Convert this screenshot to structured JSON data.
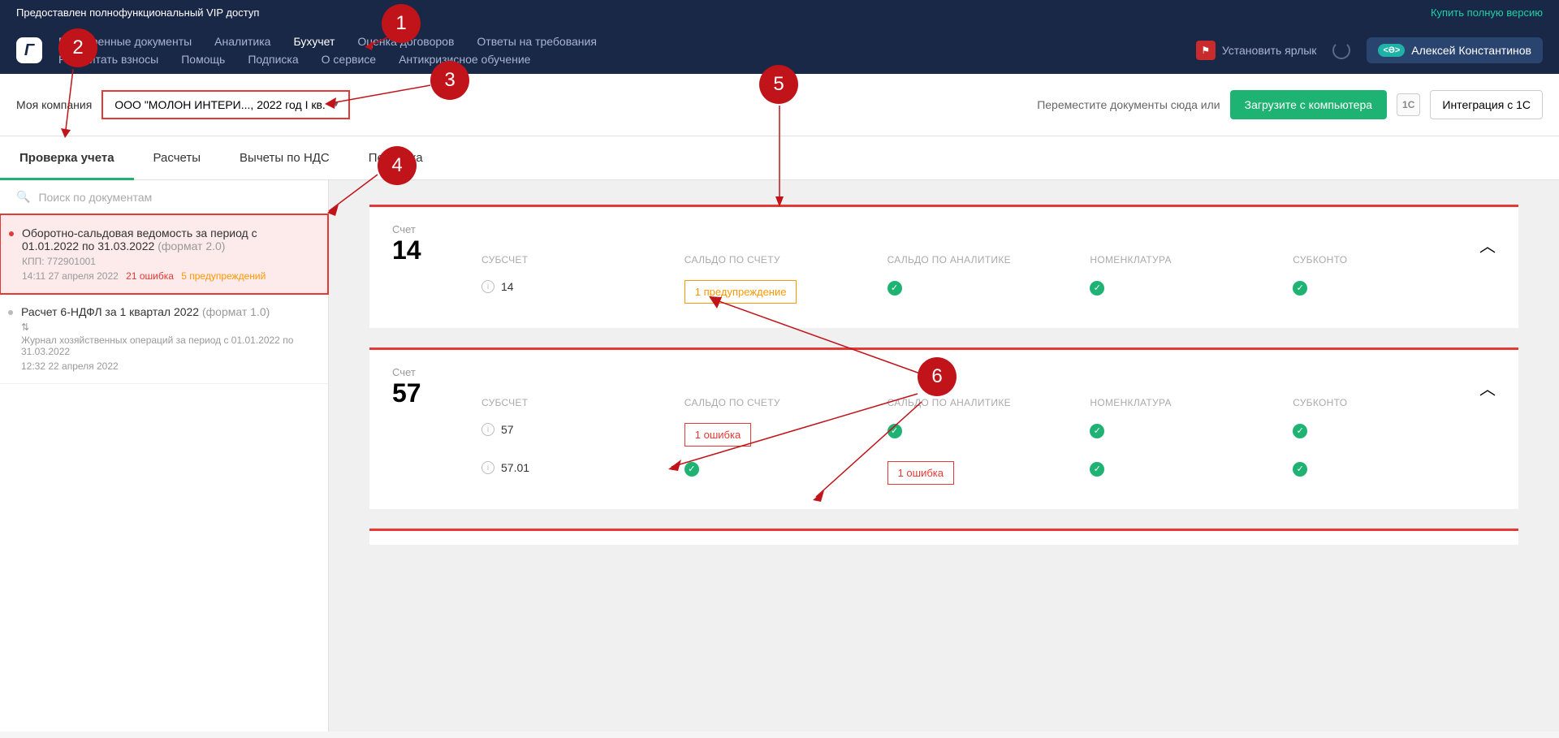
{
  "vip": {
    "text": "Предоставлен полнофункциональный VIP доступ",
    "buy": "Купить полную версию"
  },
  "nav": {
    "row1": [
      "Проверенные документы",
      "Аналитика",
      "Бухучет",
      "Оценка договоров",
      "Ответы на требования"
    ],
    "row2": [
      "Рассчитать взносы",
      "Помощь",
      "Подписка",
      "О сервисе",
      "Антикризисное обучение"
    ],
    "active": "Бухучет",
    "shortcut": "Установить ярлык",
    "user": "Алексей Константинов"
  },
  "toolbar": {
    "label": "Моя компания",
    "company": "ООО \"МОЛОН ИНТЕРИ...,  2022 год I кв.",
    "drop": "Переместите документы сюда или",
    "upload": "Загрузите с компьютера",
    "int1c_icon": "1С",
    "int1c": "Интеграция с 1С"
  },
  "tabs": [
    "Проверка учета",
    "Расчеты",
    "Вычеты по НДС",
    "Первичка"
  ],
  "search": {
    "placeholder": "Поиск по документам"
  },
  "docs": [
    {
      "title": "Оборотно-сальдовая ведомость за период с 01.01.2022 по 31.03.2022",
      "format": "(формат 2.0)",
      "kpp": "КПП: 772901001",
      "time": "14:11 27 апреля 2022",
      "errors": "21 ошибка",
      "warnings": "5 предупреждений",
      "active": true
    },
    {
      "title": "Расчет 6-НДФЛ за 1 квартал 2022",
      "format": "(формат 1.0)",
      "journal": "Журнал хозяйственных операций за период с 01.01.2022 по 31.03.2022",
      "time": "12:32 22 апреля 2022",
      "active": false
    }
  ],
  "columns": [
    "СУБСЧЕТ",
    "САЛЬДО ПО СЧЕТУ",
    "САЛЬДО ПО АНАЛИТИКЕ",
    "НОМЕНКЛАТУРА",
    "СУБКОНТО"
  ],
  "labels": {
    "account": "Счет",
    "warn1": "1 предупреждение",
    "err1": "1 ошибка"
  },
  "accounts": [
    {
      "number": "14",
      "rows": [
        {
          "sub": "14",
          "cells": [
            "warn",
            "ok",
            "ok",
            "ok"
          ]
        }
      ]
    },
    {
      "number": "57",
      "rows": [
        {
          "sub": "57",
          "cells": [
            "err",
            "ok",
            "ok",
            "ok"
          ]
        },
        {
          "sub": "57.01",
          "cells": [
            "ok",
            "err",
            "ok",
            "ok"
          ]
        }
      ]
    }
  ],
  "callouts": {
    "1": "1",
    "2": "2",
    "3": "3",
    "4": "4",
    "5": "5",
    "6": "6"
  }
}
